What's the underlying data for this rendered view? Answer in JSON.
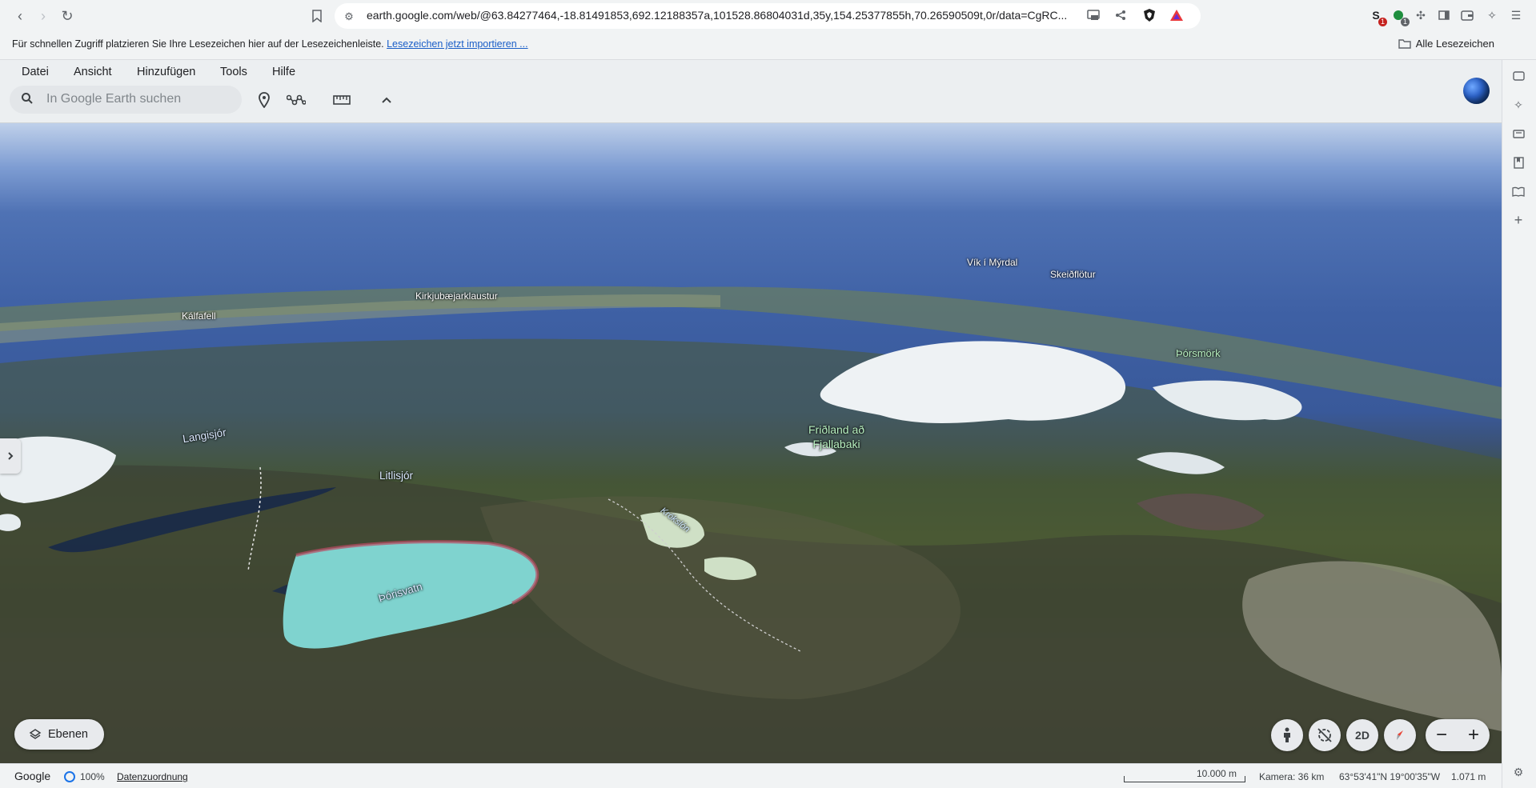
{
  "browser": {
    "url": "earth.google.com/web/@63.84277464,-18.81491853,692.12188357a,101528.86804031d,35y,154.25377855h,70.26590509t,0r/data=CgRC...",
    "badges": {
      "ext1": "1",
      "ext2": "1"
    }
  },
  "bookmarks": {
    "hint": "Für schnellen Zugriff platzieren Sie Ihre Lesezeichen hier auf der Lesezeichenleiste.",
    "import_link": "Lesezeichen jetzt importieren ...",
    "all_bookmarks": "Alle Lesezeichen"
  },
  "earth": {
    "menu": [
      "Datei",
      "Ansicht",
      "Hinzufügen",
      "Tools",
      "Hilfe"
    ],
    "search_placeholder": "In Google Earth suchen"
  },
  "map": {
    "labels": {
      "vik": "Vík í Mýrdal",
      "skeid": "Skeiðflötur",
      "kirkju": "Kirkjubæjarklaustur",
      "kalfafell": "Kálfafell",
      "thorsmork": "Þórsmörk",
      "langisjor": "Langisjór",
      "litlisjor": "Litlisjór",
      "fridland_1": "Friðland að",
      "fridland_2": "Fjallabaki",
      "krokslon": "Krókslón",
      "thorisvatn": "Þórisvatn"
    },
    "layers_label": "Ebenen",
    "ctrl_2d": "2D"
  },
  "status": {
    "brand": "Google",
    "loading": "100%",
    "attribution": "Datenzuordnung",
    "scale": "10.000 m",
    "camera": "Kamera: 36 km",
    "coords": "63°53'41\"N 19°00'35\"W",
    "elevation": "1.071 m"
  },
  "colors": {
    "accent_link": "#1a5ec7",
    "ocean": "#3e60a4",
    "ice": "#eef2f4",
    "lagoon": "#7fd3cf"
  },
  "icons": [
    "back-icon",
    "forward-icon",
    "reload-icon",
    "bookmark-icon",
    "site-info-icon",
    "cast-icon",
    "share-icon",
    "brave-shield-icon",
    "brave-rewards-icon",
    "search-icon",
    "placemark-icon",
    "path-icon",
    "ruler-icon",
    "chevron-up-icon",
    "pegman-icon",
    "tilt-icon",
    "compass-icon",
    "layers-icon"
  ]
}
